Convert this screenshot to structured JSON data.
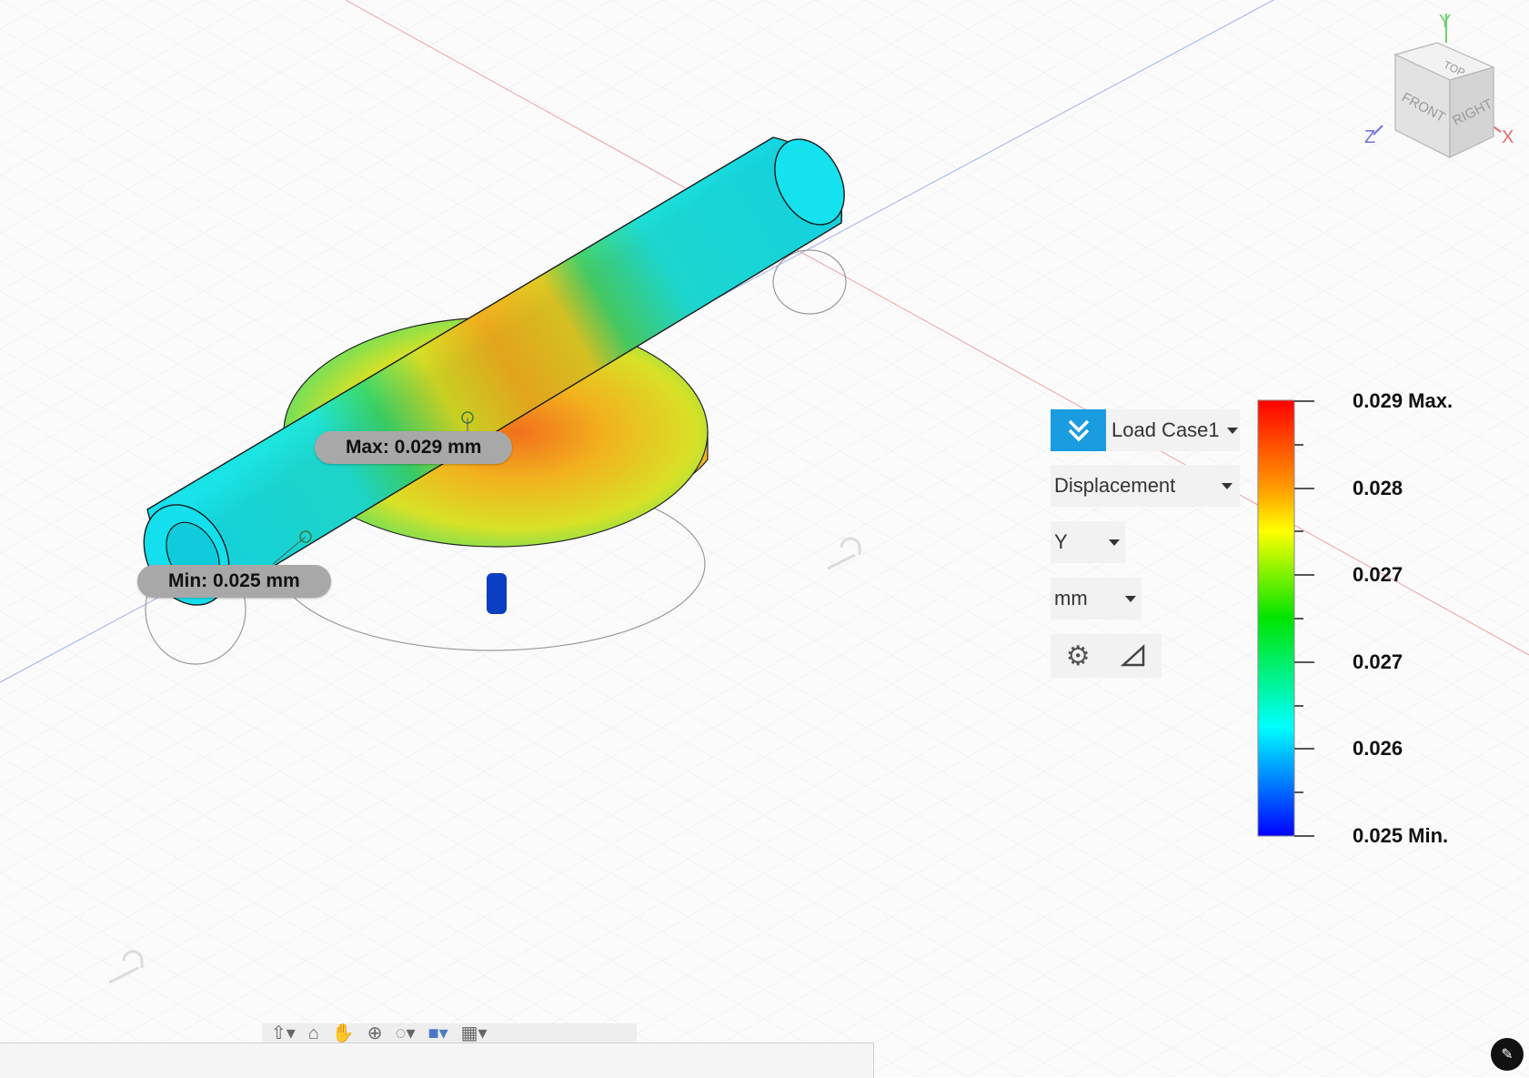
{
  "markers": {
    "max_label": "Max: 0.029 mm",
    "min_label": "Min: 0.025 mm"
  },
  "panel": {
    "load_case": "Load Case1",
    "result_type": "Displacement",
    "component": "Y",
    "units": "mm"
  },
  "legend": {
    "max_value": "0.029 Max.",
    "values": [
      "0.028",
      "0.027",
      "0.027",
      "0.026"
    ],
    "min_value": "0.025 Min."
  },
  "viewcube": {
    "top": "TOP",
    "front": "FRONT",
    "right": "RIGHT",
    "axis_x": "X",
    "axis_y": "Y",
    "axis_z": "Z"
  },
  "colors": {
    "accent": "#1a9ce0",
    "scale_top": "#ff0000",
    "scale_bottom": "#0000ff"
  },
  "icons": {
    "panel": [
      "chevron-double-down-icon",
      "gear-icon",
      "triangle-icon"
    ],
    "toolbar": [
      "orbit-icon",
      "look-at-icon",
      "pan-icon",
      "zoom-icon",
      "fit-icon",
      "display-mode-icon",
      "grid-icon"
    ]
  }
}
